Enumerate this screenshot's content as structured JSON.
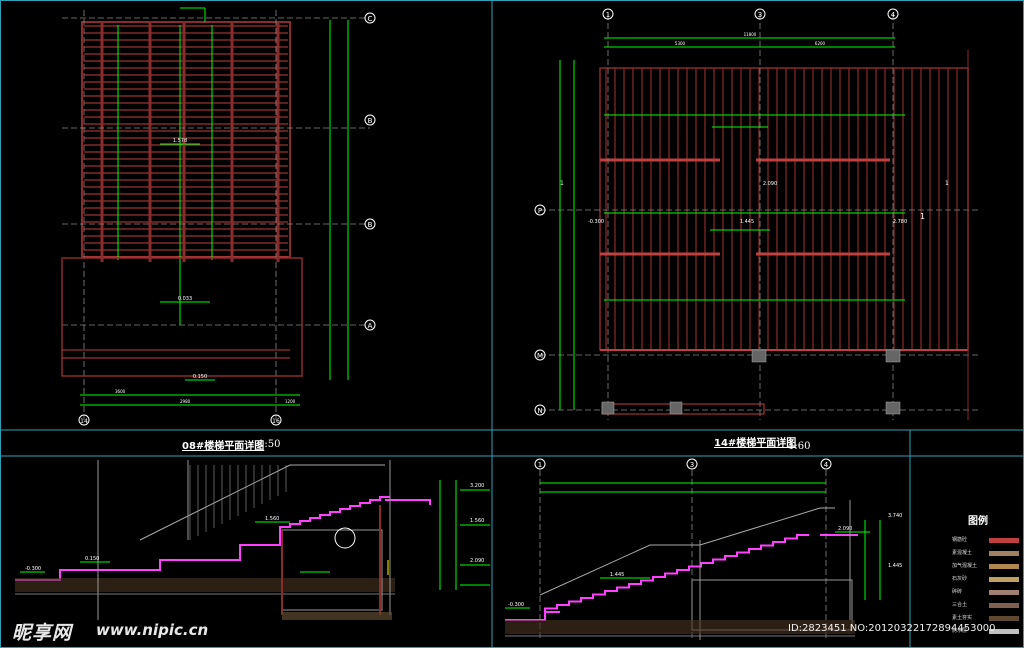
{
  "colors": {
    "background": "#000000",
    "frame": "#2fa0b8",
    "dimension": "#00ff00",
    "structure": "#8b2c2c",
    "grid_axis": "#ffffff",
    "concrete_hatch": "#c04040",
    "section_fill": "#ff40ff",
    "text": "#ffffff",
    "yellow": "#ffff00"
  },
  "plan_08": {
    "caption": "08#楼梯平面详图",
    "scale": "1:50",
    "axis_top": [
      "C",
      "B",
      "B",
      "A"
    ],
    "axis_bottom": [
      "14",
      "16"
    ],
    "dims_bottom": [
      "3600",
      "50",
      "50",
      "2980",
      "50",
      "3800",
      "1200"
    ],
    "labels": [
      "1.578",
      "0.033",
      "0.150",
      "2",
      "1",
      "1"
    ]
  },
  "plan_14": {
    "caption": "14#楼梯平面详图",
    "scale": "1:60",
    "axis_top": [
      "1",
      "3",
      "4"
    ],
    "axis_left": [
      "P",
      "M",
      "N"
    ],
    "dims_top": [
      "11800",
      "5300",
      "6200",
      "1550"
    ],
    "labels": [
      "1.445",
      "-0.300",
      "2.780",
      "2.090",
      "1",
      "1",
      "1"
    ]
  },
  "section_08": {
    "labels": [
      "1.560",
      "3.200",
      "1.560",
      "0.150",
      "-0.300",
      "2.090"
    ]
  },
  "section_14": {
    "axis_top": [
      "1",
      "3",
      "4"
    ],
    "labels": [
      "3.740",
      "2.090",
      "1.445",
      "-0.300",
      "1.445"
    ]
  },
  "legend": {
    "title": "图例",
    "rows": [
      {
        "name": "钢筋砼",
        "color": "#c04040"
      },
      {
        "name": "素混凝土",
        "color": "#a08060"
      },
      {
        "name": "加气混凝土",
        "color": "#b08850"
      },
      {
        "name": "石灰砂",
        "color": "#c0a060"
      },
      {
        "name": "碎砖",
        "color": "#a08070"
      },
      {
        "name": "三合土",
        "color": "#806050"
      },
      {
        "name": "素土夯实",
        "color": "#604830"
      },
      {
        "name": "防水层",
        "color": "#c0c0c0"
      }
    ]
  },
  "watermark": {
    "brand": "昵享网",
    "url": "www.nipic.cn",
    "id": "ID:2823451 NO:20120322172894453000"
  }
}
